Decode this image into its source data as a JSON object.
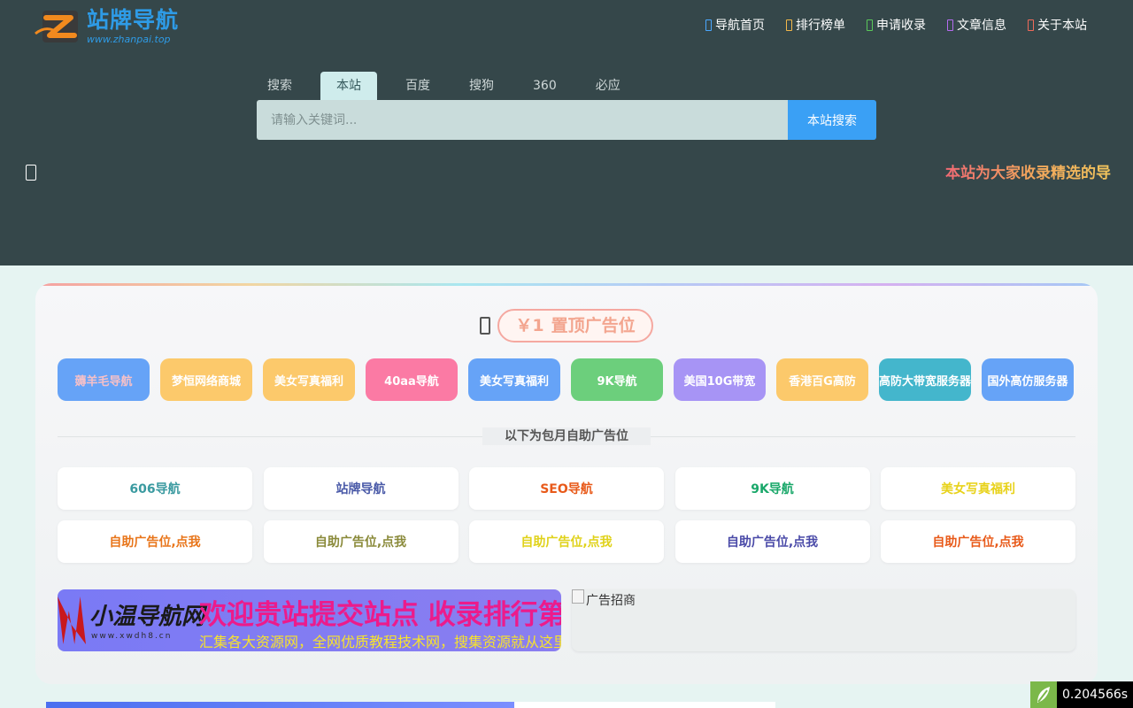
{
  "header": {
    "logo_title": "站牌导航",
    "logo_subtitle": "www.zhanpai.top",
    "nav": [
      {
        "label": "导航首页",
        "icon": "home-icon",
        "color": "#4aa8ff"
      },
      {
        "label": "排行榜单",
        "icon": "ranking-icon",
        "color": "#f2b84a"
      },
      {
        "label": "申请收录",
        "icon": "submit-icon",
        "color": "#5ac85a"
      },
      {
        "label": "文章信息",
        "icon": "article-icon",
        "color": "#b56cf0"
      },
      {
        "label": "关于本站",
        "icon": "about-icon",
        "color": "#f06a5a"
      }
    ]
  },
  "search": {
    "tabs": [
      {
        "label": "搜索",
        "active": false
      },
      {
        "label": "本站",
        "active": true
      },
      {
        "label": "百度",
        "active": false
      },
      {
        "label": "搜狗",
        "active": false
      },
      {
        "label": "360",
        "active": false
      },
      {
        "label": "必应",
        "active": false
      }
    ],
    "placeholder": "请输入关键词...",
    "button_label": "本站搜索"
  },
  "notice": {
    "text": "本站为大家收录精选的导"
  },
  "pinned": {
    "price": "￥1",
    "label": "置顶广告位",
    "ads": [
      {
        "label": "薅羊毛导航",
        "bg": "#66a3f7",
        "color": "#f5c0c8"
      },
      {
        "label": "梦恒网络商城",
        "bg": "#fcc96b",
        "color": "#ffffff"
      },
      {
        "label": "美女写真福利",
        "bg": "#fcc96b",
        "color": "#ffffff"
      },
      {
        "label": "40aa导航",
        "bg": "#fb7aa4",
        "color": "#ffffff"
      },
      {
        "label": "美女写真福利",
        "bg": "#66a3f7",
        "color": "#ffffff"
      },
      {
        "label": "9K导航",
        "bg": "#6ccf7c",
        "color": "#ffffff"
      },
      {
        "label": "美国10G带宽",
        "bg": "#a794f5",
        "color": "#ffffff"
      },
      {
        "label": "香港百G高防",
        "bg": "#fcc96b",
        "color": "#ffffff"
      },
      {
        "label": "高防大带宽服务器",
        "bg": "#44b6cc",
        "color": "#ffffff"
      },
      {
        "label": "国外高仿服务器",
        "bg": "#66a3f7",
        "color": "#ffffff"
      }
    ]
  },
  "monthly": {
    "divider_label": "以下为包月自助广告位",
    "items": [
      {
        "label": "606导航",
        "color": "#3a9aa0"
      },
      {
        "label": "站牌导航",
        "color": "#4a5aa8"
      },
      {
        "label": "SEO导航",
        "color": "#e85a1a"
      },
      {
        "label": "9K导航",
        "color": "#1aa86a"
      },
      {
        "label": "美女写真福利",
        "color": "#e8d21a"
      },
      {
        "label": "自助广告位,点我",
        "color": "#e8751a"
      },
      {
        "label": "自助广告位,点我",
        "color": "#8a8a3a"
      },
      {
        "label": "自助广告位,点我",
        "color": "#e0d21a"
      },
      {
        "label": "自助广告位,点我",
        "color": "#4a4aa8"
      },
      {
        "label": "自助广告位,点我",
        "color": "#e85a1a"
      }
    ]
  },
  "banners": {
    "left": {
      "logo": "小温导航网",
      "logo_url": "www.xwdh8.cn",
      "title": "欢迎贵站提交站点 收录排行第一名",
      "desc": "汇集各大资源网，全网优质教程技术网，搜集资源就从这里开始"
    },
    "right": {
      "alt": "广告招商"
    }
  },
  "timer": {
    "value": "0.204566s"
  }
}
